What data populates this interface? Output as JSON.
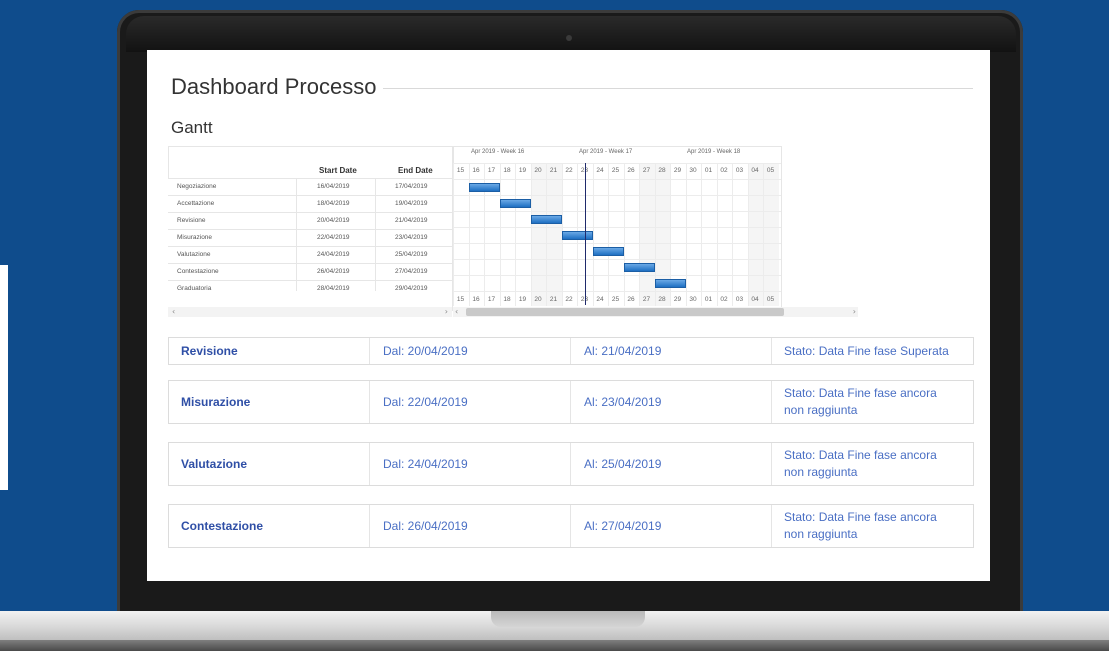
{
  "page": {
    "title": "Dashboard Processo"
  },
  "gantt": {
    "section_title": "Gantt",
    "columns": {
      "start": "Start Date",
      "end": "End Date"
    },
    "weeks": [
      "Apr 2019 - Week 16",
      "Apr 2019 - Week 17",
      "Apr 2019 - Week 18"
    ],
    "days": [
      "15",
      "16",
      "17",
      "18",
      "19",
      "20",
      "21",
      "22",
      "23",
      "24",
      "25",
      "26",
      "27",
      "28",
      "29",
      "30",
      "01",
      "02",
      "03",
      "04",
      "05"
    ],
    "rows": [
      {
        "name": "Negoziazione",
        "start": "16/04/2019",
        "end": "17/04/2019"
      },
      {
        "name": "Accettazione",
        "start": "18/04/2019",
        "end": "19/04/2019"
      },
      {
        "name": "Revisione",
        "start": "20/04/2019",
        "end": "21/04/2019"
      },
      {
        "name": "Misurazione",
        "start": "22/04/2019",
        "end": "23/04/2019"
      },
      {
        "name": "Valutazione",
        "start": "24/04/2019",
        "end": "25/04/2019"
      },
      {
        "name": "Contestazione",
        "start": "26/04/2019",
        "end": "27/04/2019"
      },
      {
        "name": "Graduatoria",
        "start": "28/04/2019",
        "end": "29/04/2019"
      }
    ],
    "scroll_left_arrow": "‹",
    "scroll_right_arrow": "›",
    "scroll_right_arrow_left": "‹"
  },
  "phases": [
    {
      "name": "Revisione",
      "from": "Dal: 20/04/2019",
      "to": "Al: 21/04/2019",
      "status": "Stato: Data Fine fase Superata"
    },
    {
      "name": "Misurazione",
      "from": "Dal: 22/04/2019",
      "to": "Al: 23/04/2019",
      "status": "Stato: Data Fine fase ancora non raggiunta"
    },
    {
      "name": "Valutazione",
      "from": "Dal: 24/04/2019",
      "to": "Al: 25/04/2019",
      "status": "Stato: Data Fine fase ancora non raggiunta"
    },
    {
      "name": "Contestazione",
      "from": "Dal: 26/04/2019",
      "to": "Al: 27/04/2019",
      "status": "Stato: Data Fine fase ancora non raggiunta"
    }
  ],
  "colors": {
    "background": "#0f4c8c",
    "bar": "#1e6fc2",
    "link": "#4a6fc4",
    "phase_name": "#2f4fa6"
  }
}
